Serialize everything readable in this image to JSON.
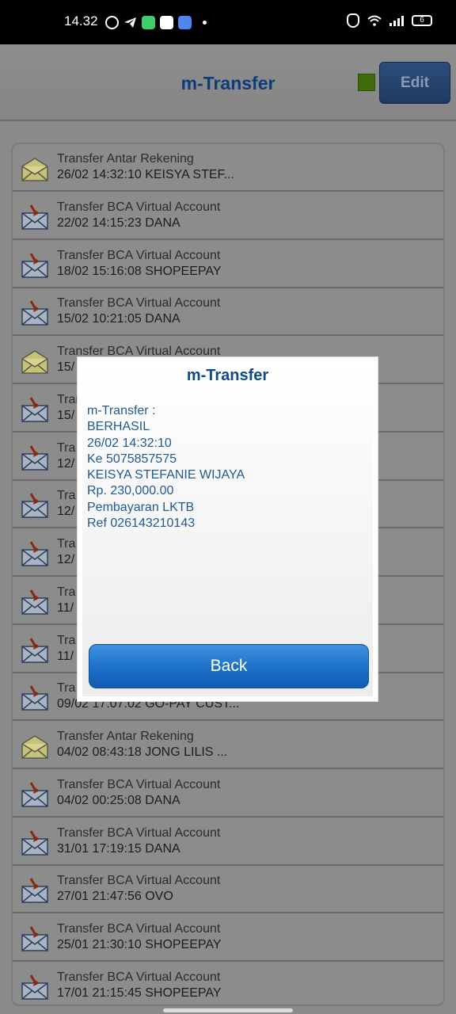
{
  "status_bar": {
    "time": "14.32",
    "battery": "6"
  },
  "header": {
    "title": "m-Transfer",
    "edit_label": "Edit"
  },
  "rows": [
    {
      "icon": "envelope-open-icon",
      "title": "Transfer Antar Rekening",
      "sub": "26/02 14:32:10 KEISYA STEF..."
    },
    {
      "icon": "envelope-arrow-icon",
      "title": "Transfer BCA Virtual Account",
      "sub": "22/02 14:15:23 DANA"
    },
    {
      "icon": "envelope-arrow-icon",
      "title": "Transfer BCA Virtual Account",
      "sub": "18/02 15:16:08 SHOPEEPAY"
    },
    {
      "icon": "envelope-arrow-icon",
      "title": "Transfer BCA Virtual Account",
      "sub": "15/02 10:21:05 DANA"
    },
    {
      "icon": "envelope-open-icon",
      "title": "Transfer BCA Virtual Account",
      "sub": "15/"
    },
    {
      "icon": "envelope-arrow-icon",
      "title": "Transf",
      "sub": "15/"
    },
    {
      "icon": "envelope-arrow-icon",
      "title": "Tra",
      "sub": "12/"
    },
    {
      "icon": "envelope-arrow-icon",
      "title": "Tra",
      "sub": "12/"
    },
    {
      "icon": "envelope-arrow-icon",
      "title": "Tra",
      "sub": "12/"
    },
    {
      "icon": "envelope-arrow-icon",
      "title": "Tra",
      "sub": "11/"
    },
    {
      "icon": "envelope-arrow-icon",
      "title": "Tra",
      "sub": "11/"
    },
    {
      "icon": "envelope-arrow-icon",
      "title": "Tra",
      "sub": "09/02 17:07:02 GO-PAY CUST..."
    },
    {
      "icon": "envelope-open-icon",
      "title": "Transfer Antar Rekening",
      "sub": "04/02 08:43:18 JONG LILIS ..."
    },
    {
      "icon": "envelope-arrow-icon",
      "title": "Transfer BCA Virtual Account",
      "sub": "04/02 00:25:08 DANA"
    },
    {
      "icon": "envelope-arrow-icon",
      "title": "Transfer BCA Virtual Account",
      "sub": "31/01 17:19:15 DANA"
    },
    {
      "icon": "envelope-arrow-icon",
      "title": "Transfer BCA Virtual Account",
      "sub": "27/01 21:47:56 OVO"
    },
    {
      "icon": "envelope-arrow-icon",
      "title": "Transfer BCA Virtual Account",
      "sub": "25/01 21:30:10 SHOPEEPAY"
    },
    {
      "icon": "envelope-arrow-icon",
      "title": "Transfer BCA Virtual Account",
      "sub": "17/01 21:15:45 SHOPEEPAY"
    }
  ],
  "dialog": {
    "title": "m-Transfer",
    "lines": [
      "m-Transfer :",
      "BERHASIL",
      "26/02 14:32:10",
      "Ke 5075857575",
      "KEISYA STEFANIE WIJAYA",
      "Rp. 230,000.00",
      "Pembayaran LKTB",
      "Ref 026143210143"
    ],
    "back_label": "Back"
  }
}
